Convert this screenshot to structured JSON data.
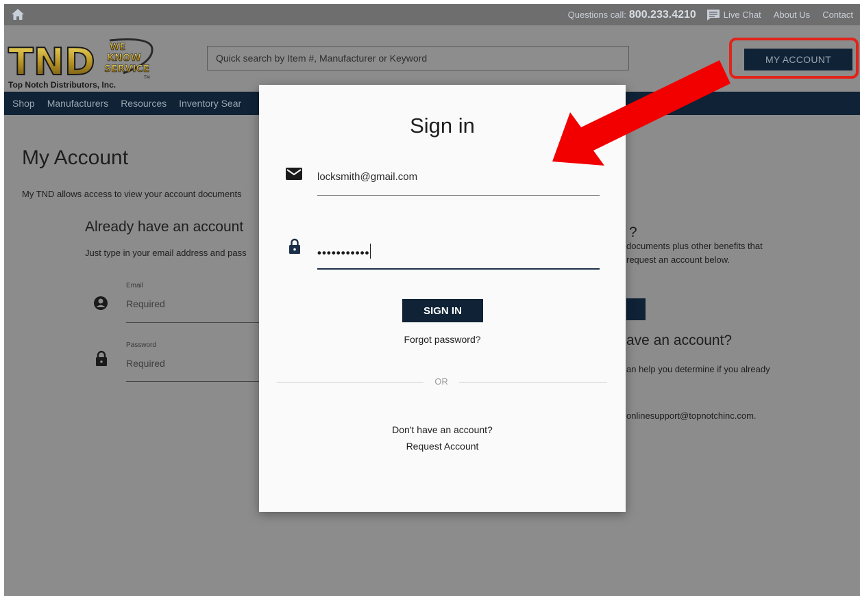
{
  "topbar": {
    "questions_label": "Questions call:",
    "phone": "800.233.4210",
    "live_chat": "Live Chat",
    "about_us": "About Us",
    "contact": "Contact"
  },
  "header": {
    "logo_letters": "TND",
    "logo_slogan": [
      "WE",
      "KNOW",
      "SERVICE"
    ],
    "logo_tm": "TM",
    "company_name": "Top Notch Distributors, Inc.",
    "search_placeholder": "Quick search by Item #, Manufacturer or Keyword",
    "my_account_button": "MY ACCOUNT"
  },
  "nav": {
    "items": [
      "Shop",
      "Manufacturers",
      "Resources",
      "Inventory Sear"
    ]
  },
  "page": {
    "title": "My Account",
    "intro": "My TND allows access to view your account documents",
    "left": {
      "heading": "Already have an account",
      "text": "Just type in your email address and pass",
      "email_label": "Email",
      "email_placeholder": "Required",
      "password_label": "Password",
      "password_placeholder": "Required"
    },
    "right": {
      "heading_a": "?",
      "text_a_line1": "documents plus other benefits that",
      "text_a_line2": "request an account below.",
      "heading_b": "ave an account?",
      "text_b": "an help you determine if you already",
      "text_c": "onlinesupport@topnotchinc.com."
    }
  },
  "modal": {
    "title": "Sign in",
    "email_value": "locksmith@gmail.com",
    "password_mask": "•••••••••••",
    "sign_in_button": "SIGN IN",
    "forgot_password": "Forgot password?",
    "or_label": "OR",
    "no_account": "Don't have an account?",
    "request_account": "Request Account"
  },
  "colors": {
    "navy": "#0f2236",
    "annotation_red": "#e2231a",
    "overlay_gray": "#8c8c8c"
  }
}
